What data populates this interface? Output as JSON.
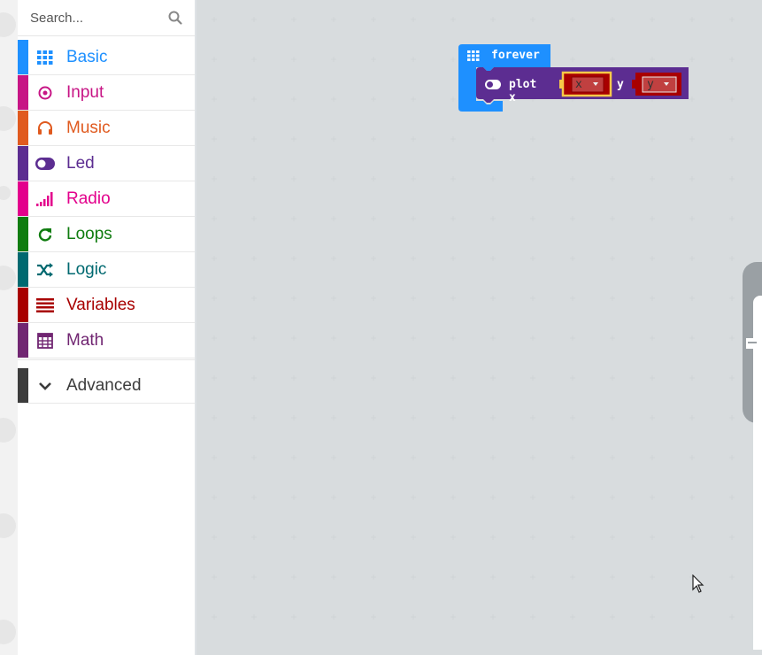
{
  "search": {
    "placeholder": "Search..."
  },
  "toolbox": {
    "categories": [
      {
        "label": "Basic",
        "color": "#1e90ff",
        "icon": "grid-icon"
      },
      {
        "label": "Input",
        "color": "#c71585",
        "icon": "target-icon"
      },
      {
        "label": "Music",
        "color": "#e05a1f",
        "icon": "headphones-icon"
      },
      {
        "label": "Led",
        "color": "#5c2d91",
        "icon": "toggle-icon"
      },
      {
        "label": "Radio",
        "color": "#e3008c",
        "icon": "signal-bars-icon"
      },
      {
        "label": "Loops",
        "color": "#107c10",
        "icon": "refresh-icon"
      },
      {
        "label": "Logic",
        "color": "#006970",
        "icon": "shuffle-icon"
      },
      {
        "label": "Variables",
        "color": "#a80000",
        "icon": "list-icon"
      },
      {
        "label": "Math",
        "color": "#712672",
        "icon": "calculator-icon"
      }
    ],
    "advanced": {
      "label": "Advanced",
      "color": "#3c3c3c",
      "icon": "chevron-down-icon"
    }
  },
  "blocks": {
    "forever": {
      "label": "forever",
      "color": "#1e90ff"
    },
    "plot": {
      "label": "plot x",
      "y_label": "y",
      "x_value": "x",
      "y_value": "y",
      "color": "#5c2d91",
      "var_color": "#a80000"
    }
  }
}
